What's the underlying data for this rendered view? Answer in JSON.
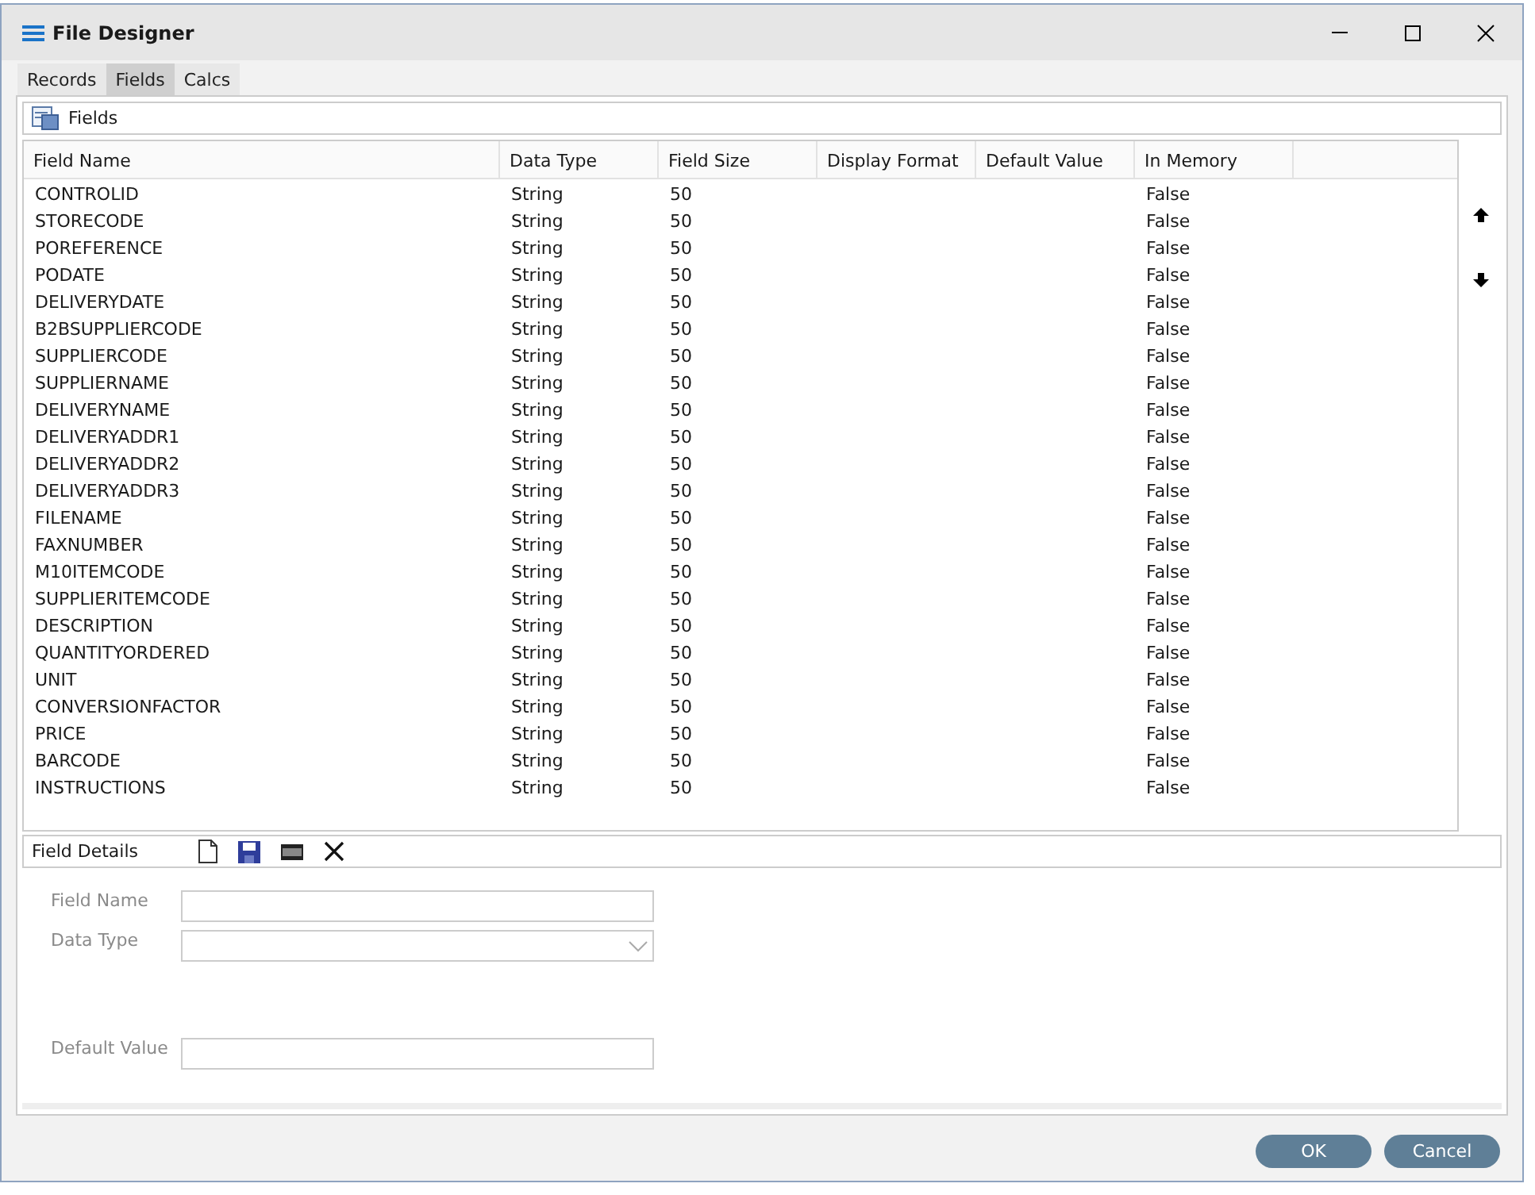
{
  "window": {
    "title": "File Designer"
  },
  "tabs": [
    {
      "label": "Records",
      "selected": false
    },
    {
      "label": "Fields",
      "selected": true
    },
    {
      "label": "Calcs",
      "selected": false
    }
  ],
  "fields_panel": {
    "title": "Fields"
  },
  "table": {
    "columns": [
      "Field Name",
      "Data Type",
      "Field Size",
      "Display Format",
      "Default Value",
      "In Memory"
    ],
    "rows": [
      [
        "CONTROLID",
        "String",
        "50",
        "",
        "",
        "False"
      ],
      [
        "STORECODE",
        "String",
        "50",
        "",
        "",
        "False"
      ],
      [
        "POREFERENCE",
        "String",
        "50",
        "",
        "",
        "False"
      ],
      [
        "PODATE",
        "String",
        "50",
        "",
        "",
        "False"
      ],
      [
        "DELIVERYDATE",
        "String",
        "50",
        "",
        "",
        "False"
      ],
      [
        "B2BSUPPLIERCODE",
        "String",
        "50",
        "",
        "",
        "False"
      ],
      [
        "SUPPLIERCODE",
        "String",
        "50",
        "",
        "",
        "False"
      ],
      [
        "SUPPLIERNAME",
        "String",
        "50",
        "",
        "",
        "False"
      ],
      [
        "DELIVERYNAME",
        "String",
        "50",
        "",
        "",
        "False"
      ],
      [
        "DELIVERYADDR1",
        "String",
        "50",
        "",
        "",
        "False"
      ],
      [
        "DELIVERYADDR2",
        "String",
        "50",
        "",
        "",
        "False"
      ],
      [
        "DELIVERYADDR3",
        "String",
        "50",
        "",
        "",
        "False"
      ],
      [
        "FILENAME",
        "String",
        "50",
        "",
        "",
        "False"
      ],
      [
        "FAXNUMBER",
        "String",
        "50",
        "",
        "",
        "False"
      ],
      [
        "M10ITEMCODE",
        "String",
        "50",
        "",
        "",
        "False"
      ],
      [
        "SUPPLIERITEMCODE",
        "String",
        "50",
        "",
        "",
        "False"
      ],
      [
        "DESCRIPTION",
        "String",
        "50",
        "",
        "",
        "False"
      ],
      [
        "QUANTITYORDERED",
        "String",
        "50",
        "",
        "",
        "False"
      ],
      [
        "UNIT",
        "String",
        "50",
        "",
        "",
        "False"
      ],
      [
        "CONVERSIONFACTOR",
        "String",
        "50",
        "",
        "",
        "False"
      ],
      [
        "PRICE",
        "String",
        "50",
        "",
        "",
        "False"
      ],
      [
        "BARCODE",
        "String",
        "50",
        "",
        "",
        "False"
      ],
      [
        "INSTRUCTIONS",
        "String",
        "50",
        "",
        "",
        "False"
      ]
    ]
  },
  "details": {
    "title": "Field Details",
    "form": [
      {
        "label": "Field Name",
        "kind": "text"
      },
      {
        "label": "Data Type",
        "kind": "dropdown"
      },
      {
        "label": "Default Value",
        "kind": "text"
      }
    ]
  },
  "buttons": [
    "OK",
    "Cancel"
  ]
}
